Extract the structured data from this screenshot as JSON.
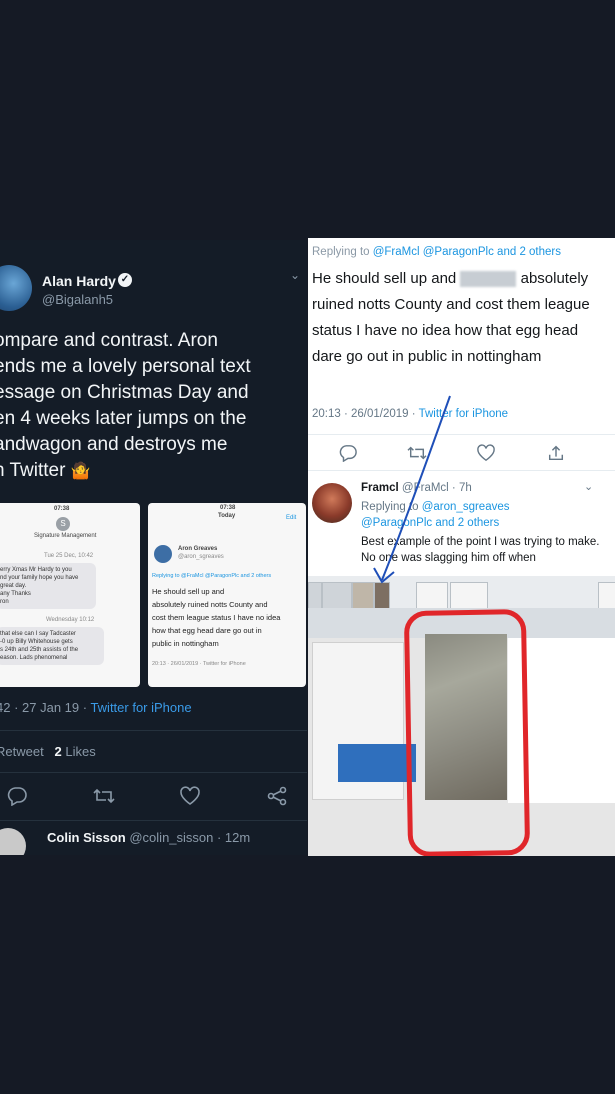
{
  "left_tweet": {
    "author_name": "Alan Hardy",
    "author_handle": "@Bigalanh5",
    "body": "ompare and contrast. Aron\nends me a lovely personal text\nessage on Christmas Day and\nen 4 weeks later jumps on the\nandwagon and destroys me\nn Twitter",
    "emoji": "🤷",
    "meta_time": "42 · 27 Jan 19 · ",
    "meta_source": "Twitter for iPhone",
    "stats_retweet": "Retweet",
    "stats_likes_count": "2",
    "stats_likes_label": "Likes",
    "reply_preview_name": "Colin Sisson",
    "reply_preview_handle": "@colin_sisson · 12m",
    "screenshot_sms": {
      "time": "07:38",
      "contact": "Signature Management",
      "date1": "Tue 25 Dec, 10:42",
      "msg1": "erry Xmas Mr Hardy to you\nnd your family hope you have\ngreat day.\nany Thanks\nron",
      "date2": "Wednesday 10:12",
      "msg2": "that else can I say Tadcaster\n-0 up Billy Whitehouse gets\ns 24th and 25th assists of the\neason. Lads phenomenal"
    },
    "screenshot_tweet": {
      "time": "07:38",
      "title": "Today",
      "edit": "Edit",
      "name": "Aron Greaves",
      "handle": "@aron_sgreaves",
      "replying": "Replying to @FraMcl @ParagonPlc and 2 others",
      "text": "He should sell up and\nabsolutely ruined notts County and\ncost them league status I have no idea\nhow that egg head dare go out in\npublic in nottingham",
      "meta": "20:13 · 26/01/2019 · Twitter for iPhone"
    }
  },
  "right_tweet": {
    "replying_prefix": "Replying to ",
    "replying_targets": "@FraMcl @ParagonPlc and 2 others",
    "text_before_blur": "He should sell up and",
    "text_after_blur": "absolutely ruined notts County and cost them league status I have no idea how that egg head dare go out in public in nottingham",
    "meta_time": "20:13 · 26/01/2019 · ",
    "meta_source": "Twitter for iPhone",
    "reply": {
      "name": "Framcl",
      "handle": "@FraMcl · 7h",
      "replying_prefix": "Replying to ",
      "replying_targets_1": "@aron_sgreaves",
      "replying_targets_2": "@ParagonPlc and 2 others",
      "text": "Best example of the point I was trying to make. No one was slagging him off when"
    }
  },
  "icons": [
    "reply-icon",
    "retweet-icon",
    "like-icon",
    "share-icon",
    "chevron-down-icon",
    "verified-badge-icon"
  ],
  "colors": {
    "twitter_blue": "#1b95e0",
    "annotation_red": "#e0262a",
    "annotation_arrow": "#1f4fb8"
  }
}
